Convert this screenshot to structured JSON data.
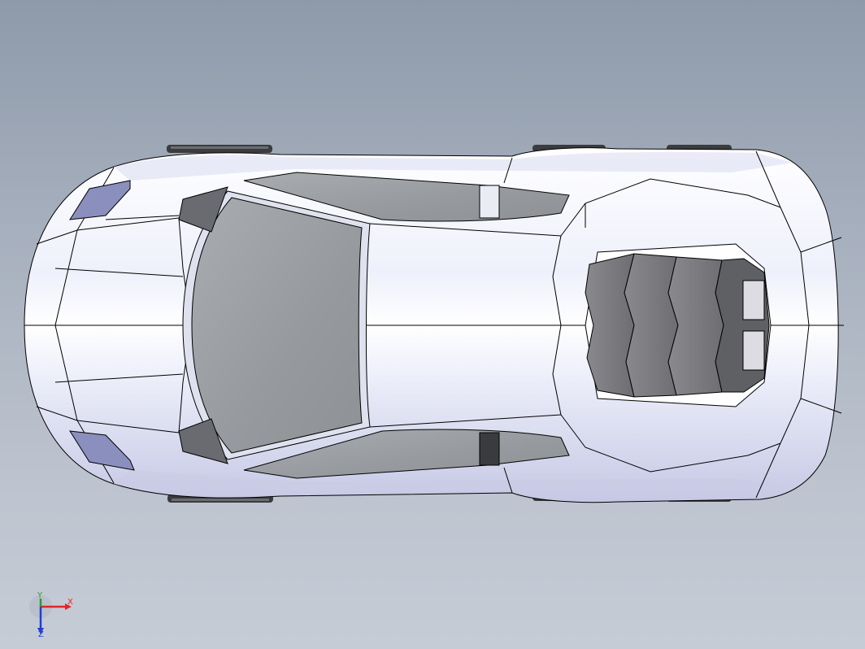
{
  "viewport": {
    "background_top": "#8e9aaa",
    "background_bottom": "#c6ccd6"
  },
  "model": {
    "body_color": "#f2f3fb",
    "body_shadow": "#c9cbe6",
    "glass_color": "#9c9fa3",
    "vent_color": "#7c7c80",
    "edge_color": "#000000"
  },
  "triad": {
    "x_label": "X",
    "y_label": "Y",
    "z_label": "Z",
    "x_color": "#e0262a",
    "y_color": "#2e9a2e",
    "z_color": "#1f3fd6"
  }
}
